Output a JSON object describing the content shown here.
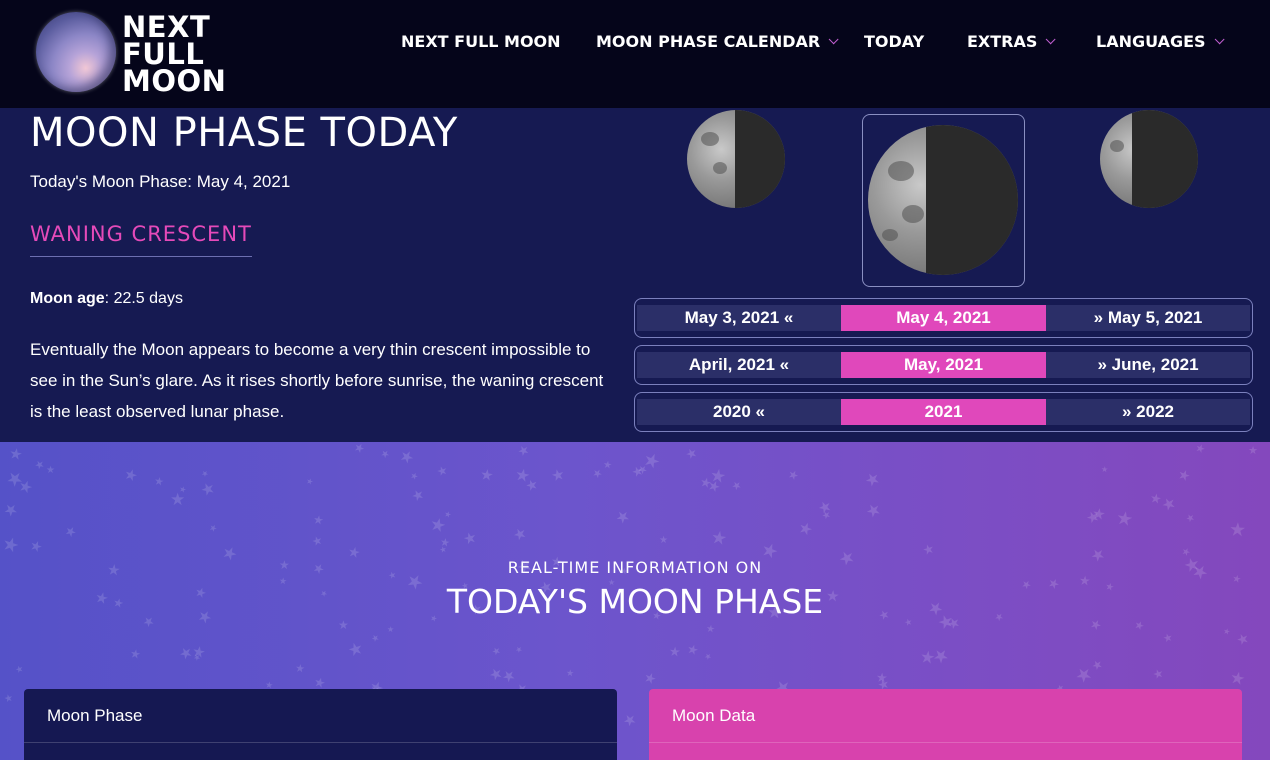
{
  "brand": {
    "line1": "NEXT",
    "line2": "FULL",
    "line3": "MOON"
  },
  "nav": {
    "items": [
      {
        "label": "NEXT FULL MOON"
      },
      {
        "label": "MOON PHASE CALENDAR"
      },
      {
        "label": "TODAY"
      },
      {
        "label": "EXTRAS"
      },
      {
        "label": "LANGUAGES"
      }
    ]
  },
  "hero": {
    "title": "MOON PHASE TODAY",
    "date_line": "Today's Moon Phase: May 4, 2021",
    "phase_name": "WANING CRESCENT",
    "age_label": "Moon age",
    "age_value": ": 22.5 days",
    "description": "Eventually the Moon appears to become a very thin crescent impossible to see in the Sun’s glare. As it rises shortly before sunrise, the waning crescent is the least observed lunar phase."
  },
  "selectors": {
    "day": {
      "prev": "May 3, 2021 «",
      "current": "May 4, 2021",
      "next": "» May 5, 2021"
    },
    "month": {
      "prev": "April, 2021 «",
      "current": "May, 2021",
      "next": "» June, 2021"
    },
    "year": {
      "prev": "2020 «",
      "current": "2021",
      "next": "» 2022"
    }
  },
  "realtime": {
    "kicker": "REAL-TIME INFORMATION ON",
    "title": "TODAY'S MOON PHASE"
  },
  "cards": {
    "phase": {
      "title": "Moon Phase"
    },
    "data": {
      "title": "Moon Data"
    }
  },
  "colors": {
    "accent_pink": "#e048bb",
    "header_bg": "#05051a",
    "hero_bg": "#161a52"
  }
}
